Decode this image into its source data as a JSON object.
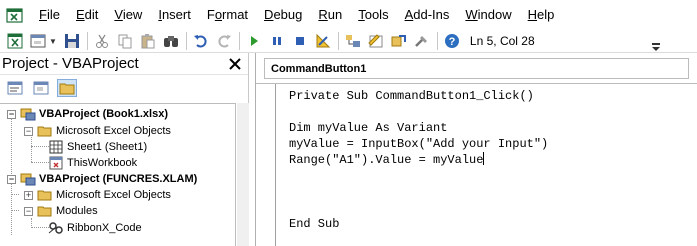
{
  "menubar": {
    "app_icon": "excel-vba-icon",
    "items": [
      {
        "label": "File",
        "u": "F",
        "rest": "ile"
      },
      {
        "label": "Edit",
        "u": "E",
        "rest": "dit"
      },
      {
        "label": "View",
        "u": "V",
        "rest": "iew"
      },
      {
        "label": "Insert",
        "u": "I",
        "rest": "nsert"
      },
      {
        "label": "Format",
        "pre": "F",
        "u": "o",
        "rest": "rmat"
      },
      {
        "label": "Debug",
        "u": "D",
        "rest": "ebug"
      },
      {
        "label": "Run",
        "u": "R",
        "rest": "un"
      },
      {
        "label": "Tools",
        "u": "T",
        "rest": "ools"
      },
      {
        "label": "Add-Ins",
        "u": "A",
        "rest": "dd-Ins"
      },
      {
        "label": "Window",
        "u": "W",
        "rest": "indow"
      },
      {
        "label": "Help",
        "u": "H",
        "rest": "elp"
      }
    ]
  },
  "toolbar": {
    "status_position": "Ln 5, Col 28",
    "icons": [
      "view-excel-icon",
      "insert-userform-icon",
      "save-icon",
      "cut-icon",
      "copy-icon",
      "paste-icon",
      "find-icon",
      "undo-icon",
      "redo-icon",
      "run-icon",
      "break-icon",
      "reset-icon",
      "design-mode-icon",
      "project-explorer-icon",
      "properties-window-icon",
      "object-browser-icon",
      "toolbox-icon",
      "help-icon"
    ]
  },
  "project_pane": {
    "title": "Project - VBAProject",
    "close_glyph": "X",
    "tree": [
      {
        "label": "VBAProject (Book1.xlsx)",
        "bold": true
      },
      {
        "label": "Microsoft Excel Objects",
        "bold": false
      },
      {
        "label": "Sheet1 (Sheet1)",
        "bold": false
      },
      {
        "label": "ThisWorkbook",
        "bold": false
      },
      {
        "label": "VBAProject (FUNCRES.XLAM)",
        "bold": true
      },
      {
        "label": "Microsoft Excel Objects",
        "bold": false
      },
      {
        "label": "Modules",
        "bold": false
      },
      {
        "label": "RibbonX_Code",
        "bold": false
      }
    ]
  },
  "code_window": {
    "object_combo": "CommandButton1",
    "lines": [
      "Private Sub CommandButton1_Click()",
      "",
      "Dim myValue As Variant",
      "myValue = InputBox(\"Add your Input\")",
      "Range(\"A1\").Value = myValue",
      "",
      "",
      "",
      "End Sub"
    ]
  },
  "colors": {
    "folder": "#e8c15a",
    "run_green": "#2d9b2d",
    "stop_blue": "#2f5fb4",
    "help_blue": "#2c6fc0"
  }
}
